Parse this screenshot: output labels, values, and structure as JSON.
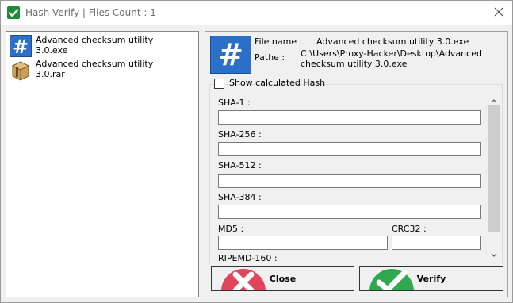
{
  "window": {
    "title": "Hash Verify | Files Count : 1"
  },
  "file_list": [
    {
      "name": "Advanced checksum utility\n3.0.exe",
      "icon": "hash-app-icon"
    },
    {
      "name": "Advanced checksum utility\n3.0.rar",
      "icon": "archive-icon"
    }
  ],
  "details": {
    "file_name_label": "File name :",
    "file_name_value": "Advanced checksum utility 3.0.exe",
    "path_label": "Pathe :",
    "path_value": "C:\\Users\\Proxy-Hacker\\Desktop\\Advanced\nchecksum utility 3.0.exe",
    "show_hash_label": "Show calculated Hash",
    "show_hash_checked": false
  },
  "hash_fields": {
    "sha1_label": "SHA-1 :",
    "sha256_label": "SHA-256 :",
    "sha512_label": "SHA-512 :",
    "sha384_label": "SHA-384 :",
    "md5_label": "MD5 :",
    "crc32_label": "CRC32 :",
    "ripemd_label": "RIPEMD-160 :",
    "sha1_value": "",
    "sha256_value": "",
    "sha512_value": "",
    "sha384_value": "",
    "md5_value": "",
    "crc32_value": ""
  },
  "buttons": {
    "close_label": "Close",
    "verify_label": "Verify"
  },
  "colors": {
    "close_accent": "#e0455b",
    "verify_accent": "#2fa84f",
    "logo_blue": "#2c6fc9"
  }
}
